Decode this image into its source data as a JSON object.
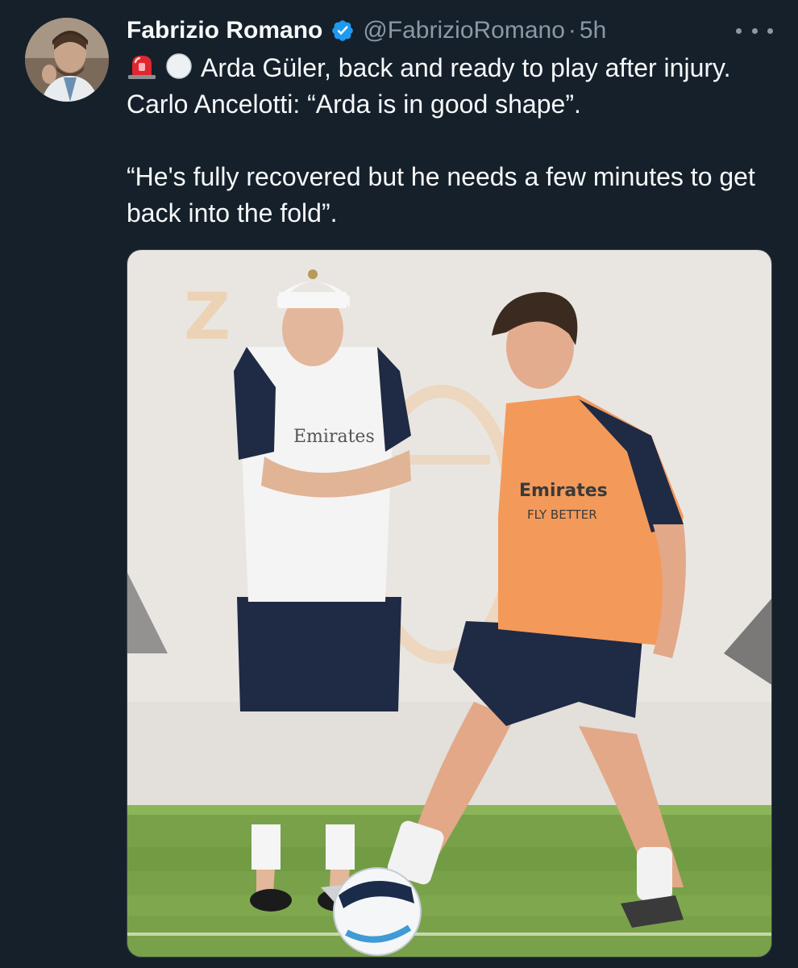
{
  "tweet": {
    "author_name": "Fabrizio Romano",
    "handle": "@FabrizioRomano",
    "separator": "·",
    "time": "5h",
    "verified_icon": "verified-badge-icon",
    "more_icon": "more-options-icon",
    "emojis": [
      "siren-emoji",
      "white-circle-emoji"
    ],
    "text_line1": "Arda Güler, back and ready to play after injury. Carlo Ancelotti: “Arda is in good shape”.",
    "text_line2": "“He's fully recovered but he needs a few minutes to get back into the fold”."
  },
  "media": {
    "kind": "photo",
    "coach_shirt_text": "Emirates",
    "bib_text_1": "Emirates",
    "bib_text_2": "FLY BETTER"
  },
  "colors": {
    "background": "#15202b",
    "text_primary": "#f7f9f9",
    "text_secondary": "#8b98a5",
    "verified": "#1d9bf0",
    "bib_orange": "#f39a5a"
  }
}
